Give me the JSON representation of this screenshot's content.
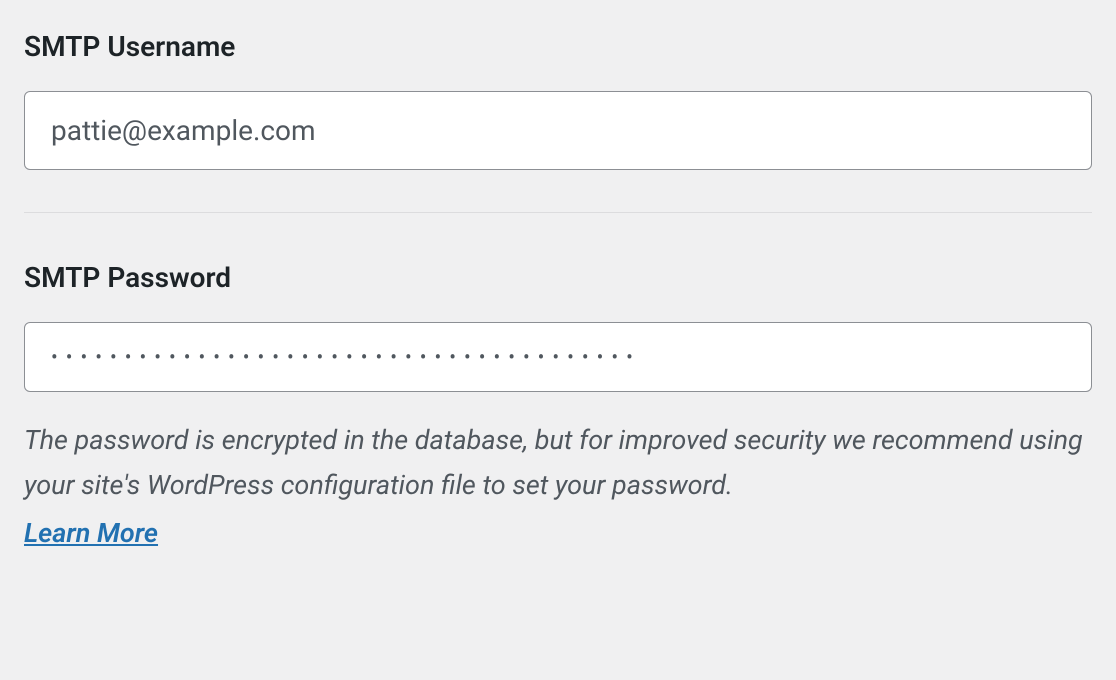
{
  "smtp": {
    "username_label": "SMTP Username",
    "username_value": "pattie@example.com",
    "password_label": "SMTP Password",
    "password_value": "••••••••••••••••••••••••••••••••••••••••",
    "password_description": "The password is encrypted in the database, but for improved security we recommend using your site's WordPress configuration file to set your password.",
    "learn_more_label": "Learn More"
  }
}
